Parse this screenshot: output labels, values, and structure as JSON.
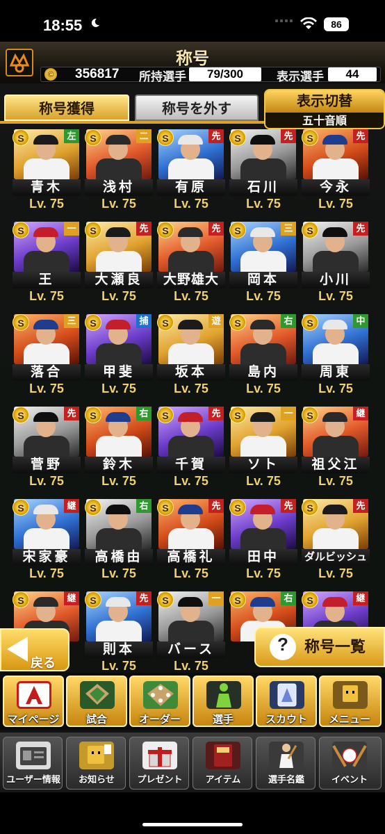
{
  "status_bar": {
    "time": "18:55",
    "battery": "86"
  },
  "header": {
    "title": "称号",
    "coins": "356817",
    "owned_label": "所持選手",
    "owned_value": "79/300",
    "displayed_label": "表示選手",
    "displayed_value": "44"
  },
  "tabs": {
    "acquire": "称号獲得",
    "remove": "称号を外す"
  },
  "display_switch": {
    "label": "表示切替",
    "value": "五十音順"
  },
  "badge_letter": "S",
  "players": [
    {
      "name": "青木",
      "level": "Lv. 75",
      "pos": "左",
      "pos_color": "#2e9a2e"
    },
    {
      "name": "浅村",
      "level": "Lv. 75",
      "pos": "二",
      "pos_color": "#e0a020"
    },
    {
      "name": "有原",
      "level": "Lv. 75",
      "pos": "先",
      "pos_color": "#c52020"
    },
    {
      "name": "石川",
      "level": "Lv. 75",
      "pos": "先",
      "pos_color": "#c52020"
    },
    {
      "name": "今永",
      "level": "Lv. 75",
      "pos": "先",
      "pos_color": "#c52020"
    },
    {
      "name": "王",
      "level": "Lv. 75",
      "pos": "一",
      "pos_color": "#e0a020"
    },
    {
      "name": "大瀬良",
      "level": "Lv. 75",
      "pos": "先",
      "pos_color": "#c52020"
    },
    {
      "name": "大野雄大",
      "level": "Lv. 75",
      "pos": "先",
      "pos_color": "#c52020"
    },
    {
      "name": "岡本",
      "level": "Lv. 75",
      "pos": "三",
      "pos_color": "#e0a020"
    },
    {
      "name": "小川",
      "level": "Lv. 75",
      "pos": "先",
      "pos_color": "#c52020"
    },
    {
      "name": "落合",
      "level": "Lv. 75",
      "pos": "三",
      "pos_color": "#e0a020"
    },
    {
      "name": "甲斐",
      "level": "Lv. 75",
      "pos": "捕",
      "pos_color": "#1f6fd0"
    },
    {
      "name": "坂本",
      "level": "Lv. 75",
      "pos": "遊",
      "pos_color": "#e0a020"
    },
    {
      "name": "島内",
      "level": "Lv. 75",
      "pos": "右",
      "pos_color": "#2e9a2e"
    },
    {
      "name": "周東",
      "level": "Lv. 75",
      "pos": "中",
      "pos_color": "#2e9a2e"
    },
    {
      "name": "菅野",
      "level": "Lv. 75",
      "pos": "先",
      "pos_color": "#c52020"
    },
    {
      "name": "鈴木",
      "level": "Lv. 75",
      "pos": "右",
      "pos_color": "#2e9a2e"
    },
    {
      "name": "千賀",
      "level": "Lv. 75",
      "pos": "先",
      "pos_color": "#c52020"
    },
    {
      "name": "ソト",
      "level": "Lv. 75",
      "pos": "一",
      "pos_color": "#e0a020"
    },
    {
      "name": "祖父江",
      "level": "Lv. 75",
      "pos": "継",
      "pos_color": "#c52020"
    },
    {
      "name": "宋家豪",
      "level": "Lv. 75",
      "pos": "継",
      "pos_color": "#c52020"
    },
    {
      "name": "高橋由",
      "level": "Lv. 75",
      "pos": "右",
      "pos_color": "#2e9a2e"
    },
    {
      "name": "高橋礼",
      "level": "Lv. 75",
      "pos": "先",
      "pos_color": "#c52020"
    },
    {
      "name": "田中",
      "level": "Lv. 75",
      "pos": "先",
      "pos_color": "#c52020"
    },
    {
      "name": "ダルビッシュ",
      "level": "Lv. 75",
      "pos": "先",
      "pos_color": "#c52020"
    },
    {
      "name": "",
      "level": "",
      "pos": "継",
      "pos_color": "#c52020"
    },
    {
      "name": "則本",
      "level": "Lv. 75",
      "pos": "先",
      "pos_color": "#c52020"
    },
    {
      "name": "バース",
      "level": "Lv. 75",
      "pos": "一",
      "pos_color": "#e0a020"
    },
    {
      "name": "",
      "level": "",
      "pos": "右",
      "pos_color": "#2e9a2e"
    },
    {
      "name": "",
      "level": "",
      "pos": "継",
      "pos_color": "#c52020"
    }
  ],
  "back_button": "戻る",
  "list_button": {
    "icon": "?",
    "label": "称号一覧"
  },
  "main_nav": [
    "マイページ",
    "試合",
    "オーダー",
    "選手",
    "スカウト",
    "メニュー"
  ],
  "sub_nav": [
    "ユーザー情報",
    "お知らせ",
    "プレゼント",
    "アイテム",
    "選手名鑑",
    "イベント"
  ]
}
